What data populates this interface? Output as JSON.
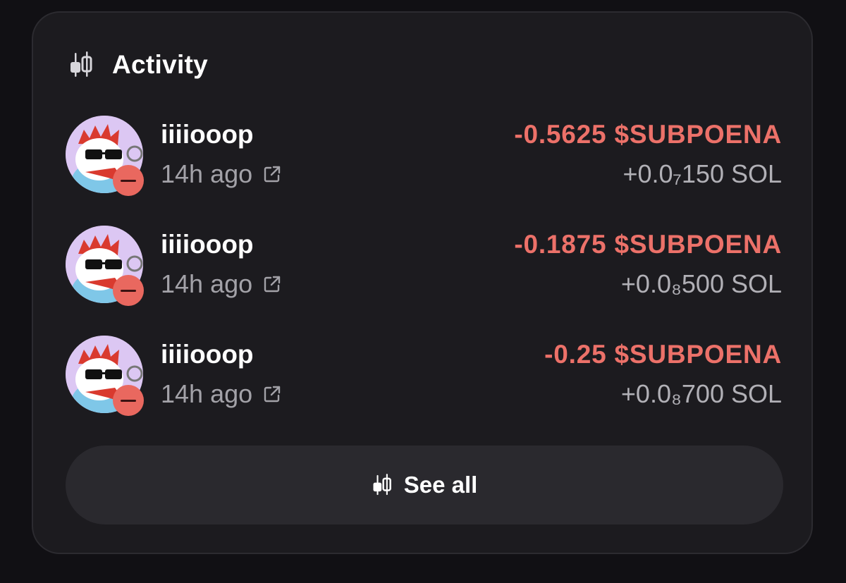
{
  "header": {
    "title": "Activity",
    "icon": "candlestick-chart-icon"
  },
  "activity": [
    {
      "user": "iiiiooop",
      "time": "14h ago",
      "amount": "-0.5625 $SUBPOENA",
      "sol": "+0.0₇150 SOL"
    },
    {
      "user": "iiiiooop",
      "time": "14h ago",
      "amount": "-0.1875 $SUBPOENA",
      "sol": "+0.0₈500 SOL"
    },
    {
      "user": "iiiiooop",
      "time": "14h ago",
      "amount": "-0.25 $SUBPOENA",
      "sol": "+0.0₈700 SOL"
    }
  ],
  "footer": {
    "see_all_label": "See all"
  },
  "colors": {
    "background": "#111014",
    "card": "#1c1b1f",
    "button": "#2a292e",
    "negative": "#ec7169",
    "muted": "#a3a2a8",
    "badge": "#e9685f"
  }
}
